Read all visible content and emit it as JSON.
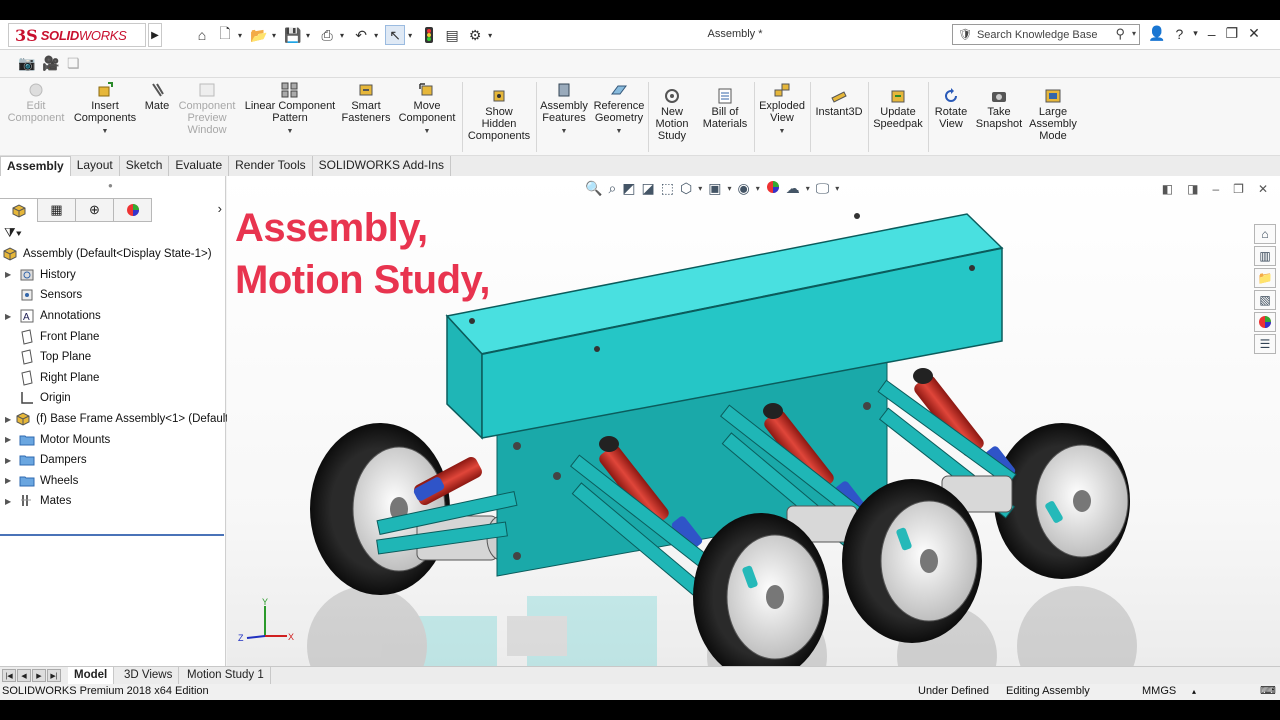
{
  "app": {
    "logo_ds": "3S",
    "logo_bold": "SOLID",
    "logo_light": "WORKS",
    "document_title": "Assembly *",
    "search_placeholder": "Search Knowledge Base"
  },
  "commands": [
    {
      "label1": "Edit",
      "label2": "Component",
      "label3": "",
      "disabled": true
    },
    {
      "label1": "Insert",
      "label2": "Components",
      "label3": "",
      "disabled": false
    },
    {
      "label1": "Mate",
      "label2": "",
      "label3": "",
      "disabled": false
    },
    {
      "label1": "Component",
      "label2": "Preview",
      "label3": "Window",
      "disabled": true
    },
    {
      "label1": "Linear Component",
      "label2": "Pattern",
      "label3": "",
      "disabled": false
    },
    {
      "label1": "Smart",
      "label2": "Fasteners",
      "label3": "",
      "disabled": false
    },
    {
      "label1": "Move",
      "label2": "Component",
      "label3": "",
      "disabled": false
    },
    {
      "label1": "Show",
      "label2": "Hidden",
      "label3": "Components",
      "disabled": false
    },
    {
      "label1": "Assembly",
      "label2": "Features",
      "label3": "",
      "disabled": false
    },
    {
      "label1": "Reference",
      "label2": "Geometry",
      "label3": "",
      "disabled": false
    },
    {
      "label1": "New",
      "label2": "Motion",
      "label3": "Study",
      "disabled": false
    },
    {
      "label1": "Bill of",
      "label2": "Materials",
      "label3": "",
      "disabled": false
    },
    {
      "label1": "Exploded",
      "label2": "View",
      "label3": "",
      "disabled": false
    },
    {
      "label1": "Instant3D",
      "label2": "",
      "label3": "",
      "disabled": false
    },
    {
      "label1": "Update",
      "label2": "Speedpak",
      "label3": "",
      "disabled": false
    },
    {
      "label1": "Rotate",
      "label2": "View",
      "label3": "",
      "disabled": false
    },
    {
      "label1": "Take",
      "label2": "Snapshot",
      "label3": "",
      "disabled": false
    },
    {
      "label1": "Large",
      "label2": "Assembly",
      "label3": "Mode",
      "disabled": false
    }
  ],
  "tabs": [
    "Assembly",
    "Layout",
    "Sketch",
    "Evaluate",
    "Render Tools",
    "SOLIDWORKS Add-Ins"
  ],
  "tree": {
    "root": "Assembly  (Default<Display State-1>)",
    "items": [
      {
        "label": "History",
        "expandable": true,
        "icon": "history-icon"
      },
      {
        "label": "Sensors",
        "expandable": false,
        "icon": "sensors-icon"
      },
      {
        "label": "Annotations",
        "expandable": true,
        "icon": "annotations-icon"
      },
      {
        "label": "Front Plane",
        "expandable": false,
        "icon": "plane-icon"
      },
      {
        "label": "Top Plane",
        "expandable": false,
        "icon": "plane-icon"
      },
      {
        "label": "Right Plane",
        "expandable": false,
        "icon": "plane-icon"
      },
      {
        "label": "Origin",
        "expandable": false,
        "icon": "origin-icon"
      },
      {
        "label": "(f) Base Frame Assembly<1> (Default",
        "expandable": true,
        "icon": "subassembly-icon"
      },
      {
        "label": "Motor Mounts",
        "expandable": true,
        "icon": "folder-icon"
      },
      {
        "label": "Dampers",
        "expandable": true,
        "icon": "folder-icon"
      },
      {
        "label": "Wheels",
        "expandable": true,
        "icon": "folder-icon"
      },
      {
        "label": "Mates",
        "expandable": true,
        "icon": "mates-icon"
      }
    ]
  },
  "bottom_tabs": [
    "Model",
    "3D Views",
    "Motion Study 1"
  ],
  "status": {
    "edition": "SOLIDWORKS Premium 2018 x64 Edition",
    "state": "Under Defined",
    "mode": "Editing Assembly",
    "units": "MMGS"
  },
  "overlay": {
    "line1": "Assembly,",
    "line2": "Motion Study,"
  },
  "triad": {
    "x": "X",
    "y": "Y",
    "z": "Z"
  },
  "colors": {
    "brand": "#c8102e",
    "overlay_text": "#e8344f",
    "body_teal": "#1fc6c6",
    "spring_red": "#d0302a",
    "damper_blue": "#2f54c8",
    "tire": "#1c1c1c"
  }
}
